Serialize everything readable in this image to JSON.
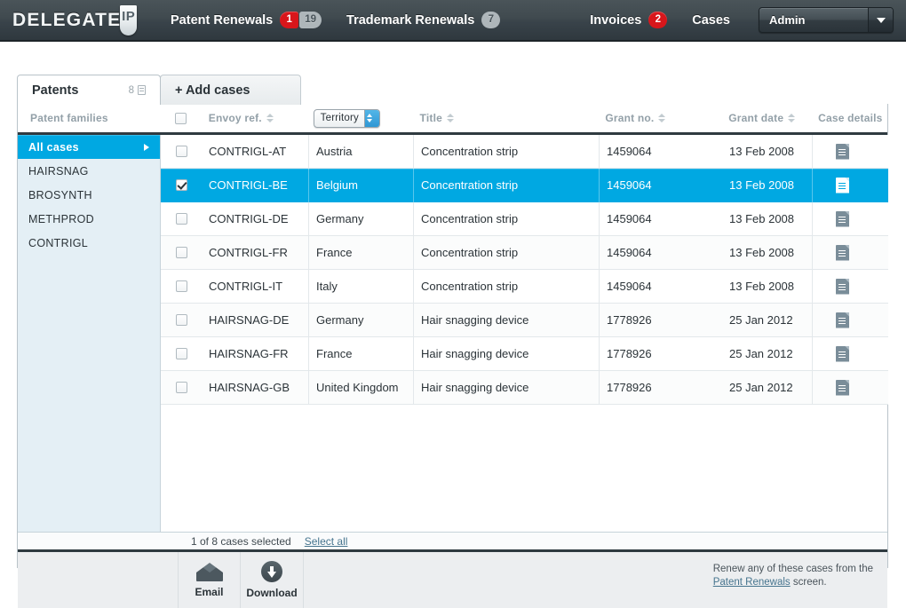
{
  "brand": {
    "name": "DELEGATE",
    "mark": "IP"
  },
  "topnav": {
    "items": [
      {
        "label": "Patent Renewals",
        "badges": [
          {
            "value": "1",
            "style": "red"
          },
          {
            "value": "19",
            "style": "grey"
          }
        ]
      },
      {
        "label": "Trademark Renewals",
        "badges": [
          {
            "value": "7",
            "style": "grey"
          }
        ]
      },
      {
        "label": "Invoices",
        "badges": [
          {
            "value": "2",
            "style": "red"
          }
        ]
      },
      {
        "label": "Cases",
        "badges": []
      }
    ],
    "user_select": {
      "value": "Admin"
    }
  },
  "tabs": [
    {
      "label": "Patents",
      "count": "8",
      "active": true
    },
    {
      "label": "+ Add cases",
      "count": "",
      "active": false
    }
  ],
  "columns": {
    "families": "Patent families",
    "envoy_ref": "Envoy ref.",
    "territory": "Territory",
    "title": "Title",
    "grant_no": "Grant no.",
    "grant_date": "Grant date",
    "case_details": "Case details"
  },
  "sidebar": {
    "items": [
      {
        "label": "All cases",
        "active": true
      },
      {
        "label": "HAIRSNAG",
        "active": false
      },
      {
        "label": "BROSYNTH",
        "active": false
      },
      {
        "label": "METHPROD",
        "active": false
      },
      {
        "label": "CONTRIGL",
        "active": false
      }
    ]
  },
  "rows": [
    {
      "checked": false,
      "selected": false,
      "envoy_ref": "CONTRIGL-AT",
      "territory": "Austria",
      "title": "Concentration strip",
      "grant_no": "1459064",
      "grant_date": "13 Feb 2008"
    },
    {
      "checked": true,
      "selected": true,
      "envoy_ref": "CONTRIGL-BE",
      "territory": "Belgium",
      "title": "Concentration strip",
      "grant_no": "1459064",
      "grant_date": "13 Feb 2008"
    },
    {
      "checked": false,
      "selected": false,
      "envoy_ref": "CONTRIGL-DE",
      "territory": "Germany",
      "title": "Concentration strip",
      "grant_no": "1459064",
      "grant_date": "13 Feb 2008"
    },
    {
      "checked": false,
      "selected": false,
      "envoy_ref": "CONTRIGL-FR",
      "territory": "France",
      "title": "Concentration strip",
      "grant_no": "1459064",
      "grant_date": "13 Feb 2008"
    },
    {
      "checked": false,
      "selected": false,
      "envoy_ref": "CONTRIGL-IT",
      "territory": "Italy",
      "title": "Concentration strip",
      "grant_no": "1459064",
      "grant_date": "13 Feb 2008"
    },
    {
      "checked": false,
      "selected": false,
      "envoy_ref": "HAIRSNAG-DE",
      "territory": "Germany",
      "title": "Hair snagging device",
      "grant_no": "1778926",
      "grant_date": "25 Jan 2012"
    },
    {
      "checked": false,
      "selected": false,
      "envoy_ref": "HAIRSNAG-FR",
      "territory": "France",
      "title": "Hair snagging device",
      "grant_no": "1778926",
      "grant_date": "25 Jan 2012"
    },
    {
      "checked": false,
      "selected": false,
      "envoy_ref": "HAIRSNAG-GB",
      "territory": "United Kingdom",
      "title": "Hair snagging device",
      "grant_no": "1778926",
      "grant_date": "25 Jan 2012"
    }
  ],
  "status": {
    "text": "1 of 8 cases selected",
    "select_all": "Select all"
  },
  "actions": [
    {
      "label": "Email",
      "icon": "envelope-icon"
    },
    {
      "label": "Download",
      "icon": "download-icon"
    }
  ],
  "footnote": {
    "before": "Renew any of these cases from the",
    "link": "Patent Renewals",
    "after": " screen."
  },
  "colors": {
    "accent_blue": "#00a8e2",
    "badge_red": "#d8161b",
    "header_dark": "#3a444a",
    "sidebar_blue": "#e4eff5"
  }
}
